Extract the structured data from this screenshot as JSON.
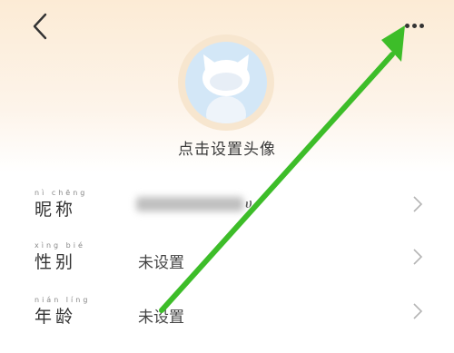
{
  "header": {
    "back_icon": "chevron-left-icon",
    "more_icon": "more-dots-icon"
  },
  "profile": {
    "avatar_caption": "点击设置头像"
  },
  "fields": [
    {
      "pinyin": "nì chēng",
      "label": "昵称",
      "value": ""
    },
    {
      "pinyin": "xìng bié",
      "label": "性别",
      "value": "未设置"
    },
    {
      "pinyin": "nián líng",
      "label": "年龄",
      "value": "未设置"
    }
  ],
  "colors": {
    "annotation_arrow": "#3dbd29",
    "header_gradient": "#fcebd5",
    "avatar_bg": "#d3e7f7"
  }
}
